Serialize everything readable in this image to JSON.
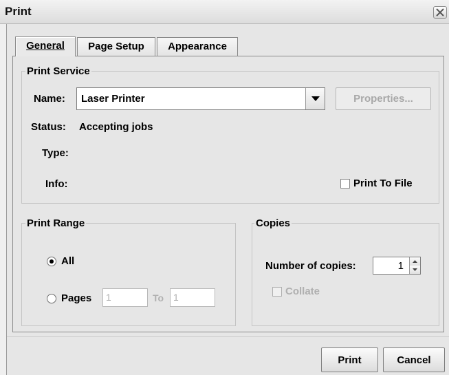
{
  "window": {
    "title": "Print"
  },
  "tabs": [
    {
      "label": "General",
      "active": true
    },
    {
      "label": "Page Setup",
      "active": false
    },
    {
      "label": "Appearance",
      "active": false
    }
  ],
  "print_service": {
    "title": "Print Service",
    "name_label": "Name:",
    "printer_name": "Laser Printer",
    "properties_label": "Properties...",
    "status_label": "Status:",
    "status_value": "Accepting jobs",
    "type_label": "Type:",
    "info_label": "Info:",
    "print_to_file_label": "Print To File",
    "print_to_file_checked": false
  },
  "print_range": {
    "title": "Print Range",
    "all_label": "All",
    "all_selected": true,
    "pages_label": "Pages",
    "pages_from": "1",
    "to_label": "To",
    "pages_to": "1"
  },
  "copies": {
    "title": "Copies",
    "number_label": "Number of copies:",
    "number_value": "1",
    "collate_label": "Collate",
    "collate_checked": false
  },
  "buttons": {
    "print": "Print",
    "cancel": "Cancel"
  },
  "icons": {
    "close": "close-icon",
    "combo_arrow": "chevron-down-icon",
    "spin_up": "spin-up-icon",
    "spin_down": "spin-down-icon"
  },
  "colors": {
    "dialog_bg": "#e6e6e6",
    "border": "#8a8a8a",
    "disabled_text": "#a8a8a8"
  }
}
